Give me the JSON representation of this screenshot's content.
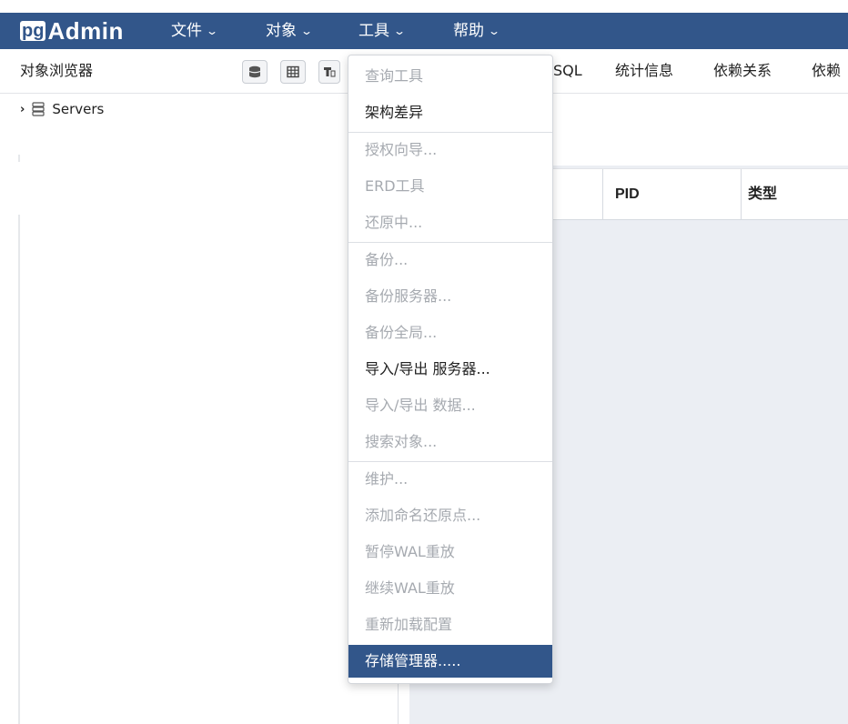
{
  "brand": {
    "pg": "pg",
    "admin": "Admin"
  },
  "topmenu": [
    {
      "label": "文件"
    },
    {
      "label": "对象"
    },
    {
      "label": "工具"
    },
    {
      "label": "帮助"
    }
  ],
  "browser": {
    "title": "对象浏览器",
    "tree_root": "Servers"
  },
  "tabs": [
    "SQL",
    "统计信息",
    "依赖关系",
    "依赖"
  ],
  "grid": {
    "columns": [
      "PID",
      "类型"
    ]
  },
  "tools_menu": {
    "items": [
      {
        "label": "查询工具",
        "state": "disabled"
      },
      {
        "label": "架构差异",
        "state": "enabled"
      },
      {
        "label": "授权向导...",
        "state": "disabled"
      },
      {
        "label": "ERD工具",
        "state": "disabled"
      },
      {
        "label": "还原中...",
        "state": "disabled"
      },
      {
        "label": "备份...",
        "state": "disabled"
      },
      {
        "label": "备份服务器...",
        "state": "disabled"
      },
      {
        "label": "备份全局...",
        "state": "disabled"
      },
      {
        "label": "导入/导出 服务器...",
        "state": "enabled"
      },
      {
        "label": "导入/导出 数据...",
        "state": "disabled"
      },
      {
        "label": "搜索对象...",
        "state": "disabled"
      },
      {
        "label": "维护...",
        "state": "disabled"
      },
      {
        "label": "添加命名还原点...",
        "state": "disabled"
      },
      {
        "label": "暂停WAL重放",
        "state": "disabled"
      },
      {
        "label": "继续WAL重放",
        "state": "disabled"
      },
      {
        "label": "重新加载配置",
        "state": "disabled"
      },
      {
        "label": "存储管理器.....",
        "state": "active"
      }
    ]
  },
  "colors": {
    "navbar": "#32568a",
    "highlight": "#32568a",
    "disabled_text": "#a6aab0"
  }
}
